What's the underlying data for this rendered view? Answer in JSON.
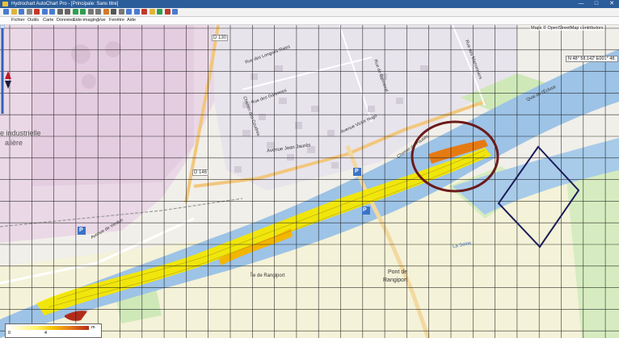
{
  "window": {
    "title": "Hydrochart AutoChart Pro - [Principale: Sans titre]",
    "controls": [
      "—",
      "□",
      "✕"
    ]
  },
  "menu": [
    "Fichier",
    "Outils",
    "Carte",
    "Données",
    "Side-imaging",
    "Vue",
    "Fenêtre",
    "Aide"
  ],
  "toolbar": {
    "buttons": [
      "new",
      "open",
      "save",
      "print",
      "cut",
      "copy",
      "paste",
      "undo",
      "redo",
      "zoom-in",
      "zoom-out",
      "pan",
      "select",
      "layers",
      "grid",
      "settings",
      "import",
      "export",
      "track",
      "depth",
      "contour",
      "color",
      "help"
    ]
  },
  "map": {
    "attribution": "Maps © OpenStreetMap contributors",
    "coordinates": "N 48° 58.142' E001° 48.",
    "labels": {
      "zone_industrielle": "e industrielle",
      "zone_sub": "alière",
      "d130": "D 130",
      "d146": "D 146",
      "avenue_jean_jaures": "Avenue Jean Jaurès",
      "rue_longues_raies": "Rue des Longues Raies",
      "rue_garennes": "Rue des Garennes",
      "chemin_coudres": "Chemin des Coudres",
      "rue_bonneval": "Rue de Bonneval",
      "avenue_victor_hugo": "Avenue Victor Hugo",
      "chemin_poulies": "Chemin de Poulies",
      "quai_peuplier": "Quai de l'Écluse",
      "ile_rangiport": "Île de Rangiport",
      "pont_rangiport_1": "Pont de",
      "pont_rangiport_2": "Rangiport",
      "la_seine": "La Seine",
      "avenue_verdun": "Avenue de Verdun",
      "rue_marronniers": "Rue des Marronniers",
      "parking1": "P",
      "parking2": "P",
      "parking3": "P"
    }
  },
  "legend": {
    "min": "0",
    "mid": "4",
    "unit": "m"
  },
  "colors": {
    "titlebar": "#2b5d9a",
    "river": "#9dc3e6",
    "depth_high": "#f4e800",
    "depth_deep": "#c84a1a",
    "circle": "#6b1a1a",
    "rect": "#1c1c5a"
  }
}
